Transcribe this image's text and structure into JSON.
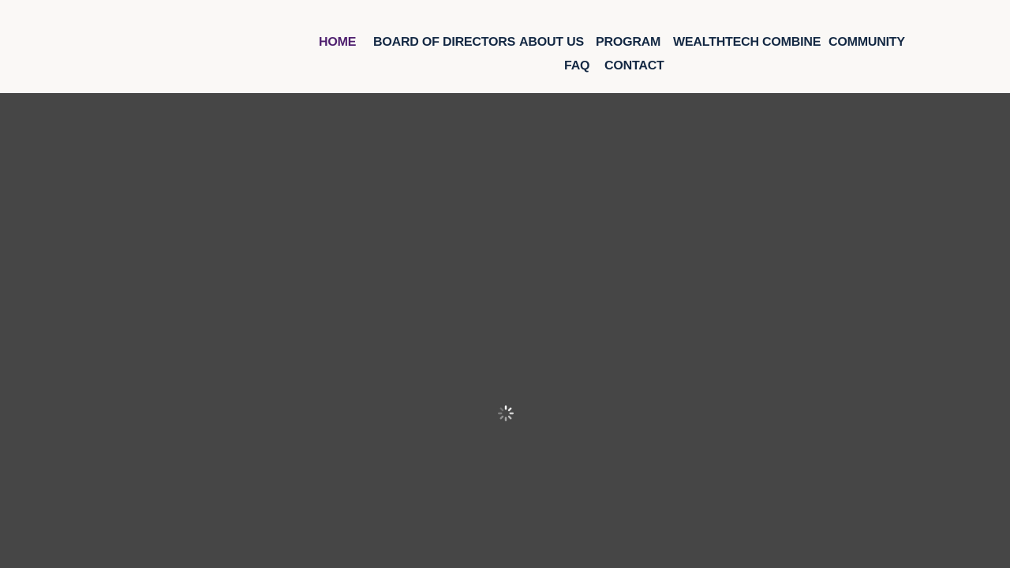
{
  "nav": {
    "items": [
      {
        "label": "HOME",
        "active": true
      },
      {
        "label": "BOARD OF DIRECTORS",
        "active": false
      },
      {
        "label": "ABOUT US",
        "active": false
      },
      {
        "label": "PROGRAM",
        "active": false
      },
      {
        "label": "WEALTHTECH COMBINE",
        "active": false
      },
      {
        "label": "COMMUNITY",
        "active": false
      },
      {
        "label": "FAQ",
        "active": false
      },
      {
        "label": "CONTACT",
        "active": false
      }
    ]
  },
  "colors": {
    "header_bg": "#faf8f6",
    "nav_text": "#132843",
    "nav_active": "#4e1f6e",
    "content_bg": "#464646"
  },
  "icons": {
    "loader": "loading-spinner-icon"
  }
}
